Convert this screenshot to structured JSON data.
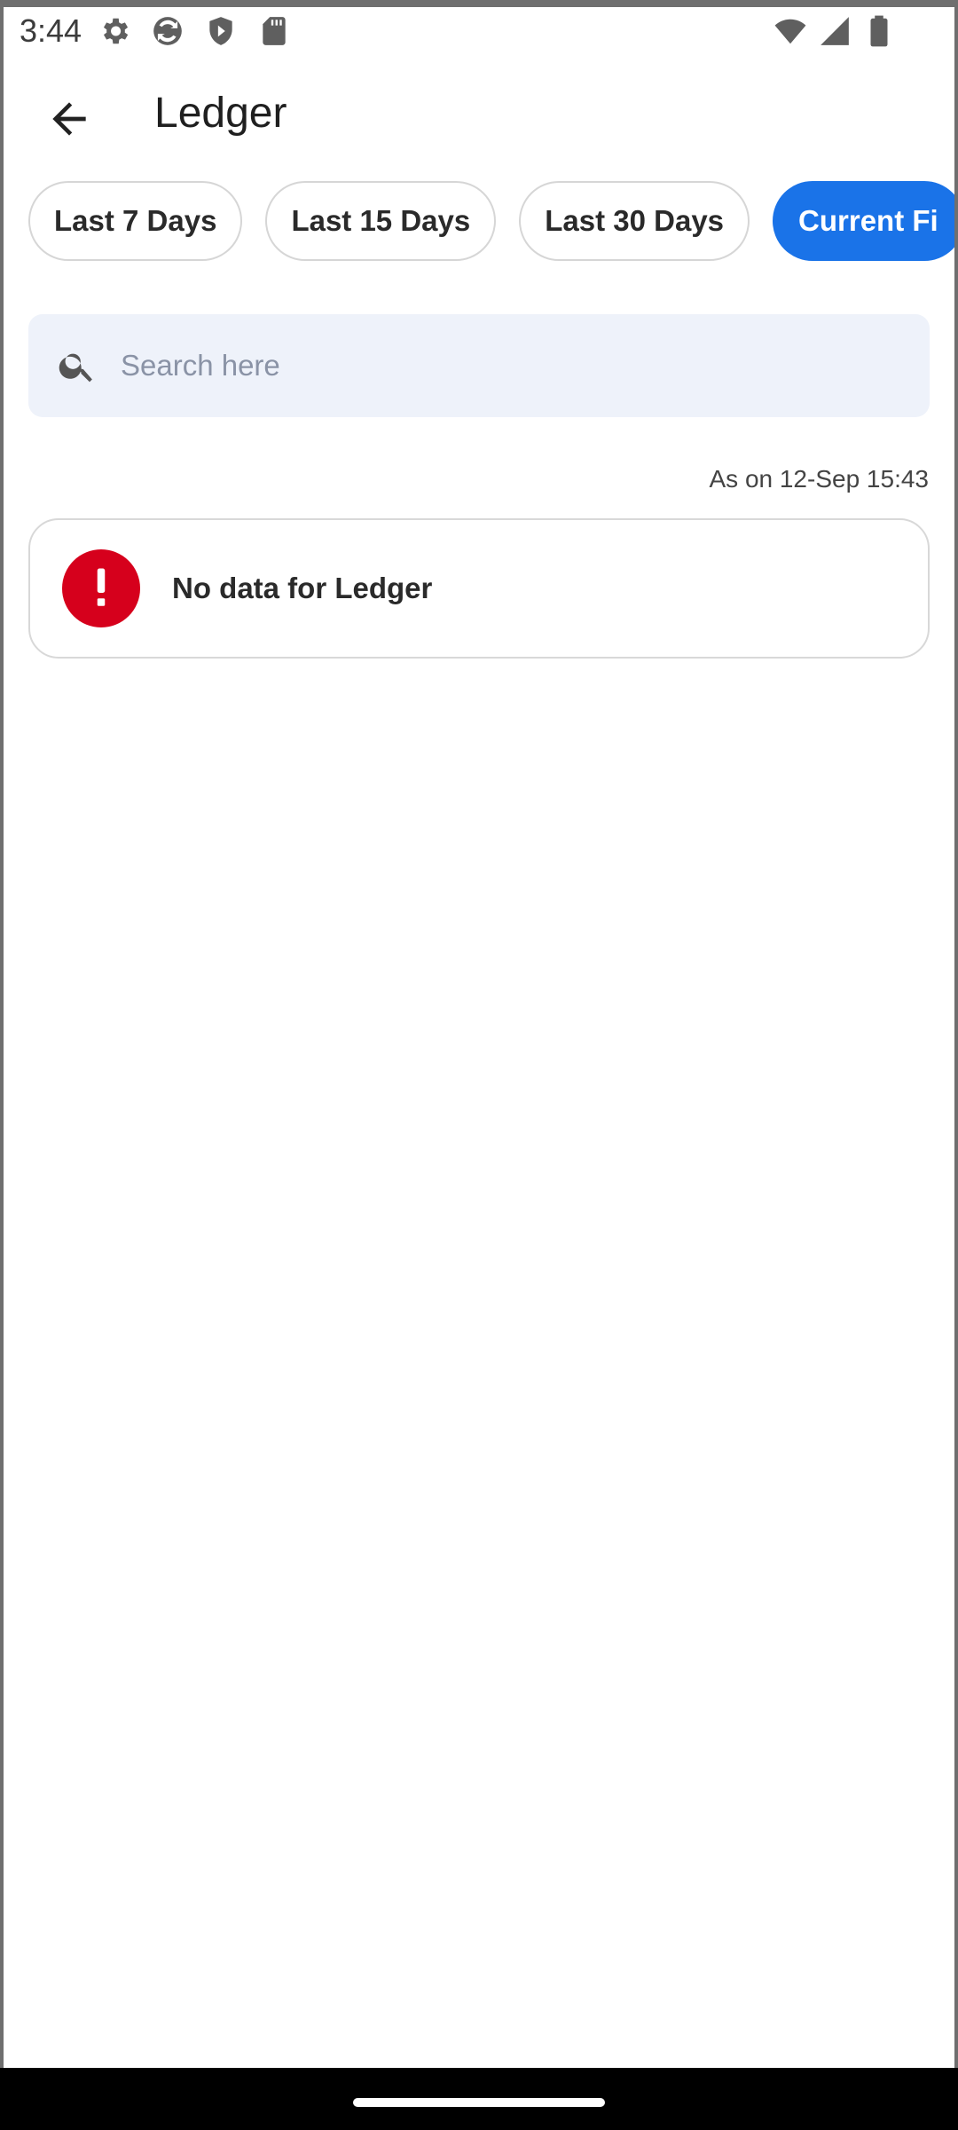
{
  "status_bar": {
    "time": "3:44",
    "left_icons": [
      "settings-gear-icon",
      "sync-icon",
      "shield-icon",
      "sd-card-icon"
    ],
    "right_icons": [
      "wifi-icon",
      "signal-icon",
      "battery-icon"
    ]
  },
  "header": {
    "title": "Ledger"
  },
  "filters": {
    "chips": [
      {
        "label": "Last 7 Days"
      },
      {
        "label": "Last 15 Days"
      },
      {
        "label": "Last 30 Days"
      },
      {
        "label": "Current Fi"
      }
    ],
    "active_index": 3
  },
  "search": {
    "placeholder": "Search here",
    "value": ""
  },
  "as_on": "As on 12-Sep 15:43",
  "empty_state": {
    "message": "No data for Ledger"
  },
  "colors": {
    "accent": "#1a73e8",
    "alert": "#d6001c",
    "search_bg": "#eef2fa"
  }
}
